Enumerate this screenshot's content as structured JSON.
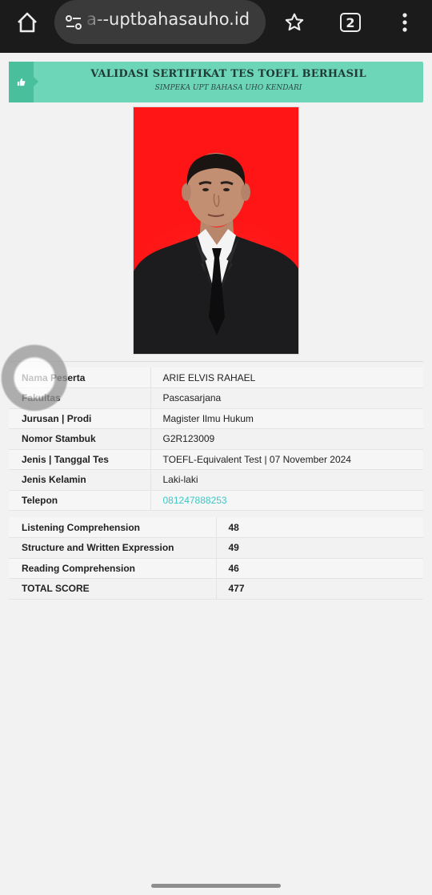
{
  "browser": {
    "url": "a--uptbahasauho.id",
    "tab_count": "2",
    "icons": [
      "home-icon",
      "site-settings-icon",
      "star-icon",
      "tabs-icon",
      "menu-icon"
    ]
  },
  "banner": {
    "title": "VALIDASI SERTIFIKAT TES TOEFL BERHASIL",
    "subtitle": "SIMPEKA UPT BAHASA UHO KENDARI",
    "icon": "thumbs-up-icon",
    "colors": {
      "background": "#6dd5b8",
      "strip": "#49bf9c"
    }
  },
  "photo": {
    "background_color": "#ff1515"
  },
  "participant": [
    {
      "label": "Nama Peserta",
      "value": "ARIE ELVIS RAHAEL"
    },
    {
      "label": "Fakultas",
      "value": "Pascasarjana"
    },
    {
      "label": "Jurusan | Prodi",
      "value": "Magister Ilmu Hukum"
    },
    {
      "label": "Nomor Stambuk",
      "value": "G2R123009"
    },
    {
      "label": "Jenis | Tanggal Tes",
      "value": "TOEFL-Equivalent Test | 07 November 2024"
    },
    {
      "label": "Jenis Kelamin",
      "value": "Laki-laki"
    },
    {
      "label": "Telepon",
      "value": "081247888253"
    }
  ],
  "scores": [
    {
      "label": "Listening Comprehension",
      "value": "48"
    },
    {
      "label": "Structure and Written Expression",
      "value": "49"
    },
    {
      "label": "Reading Comprehension",
      "value": "46"
    },
    {
      "label": "TOTAL SCORE",
      "value": "477"
    }
  ],
  "colors": {
    "link": "#3cc7c7"
  }
}
